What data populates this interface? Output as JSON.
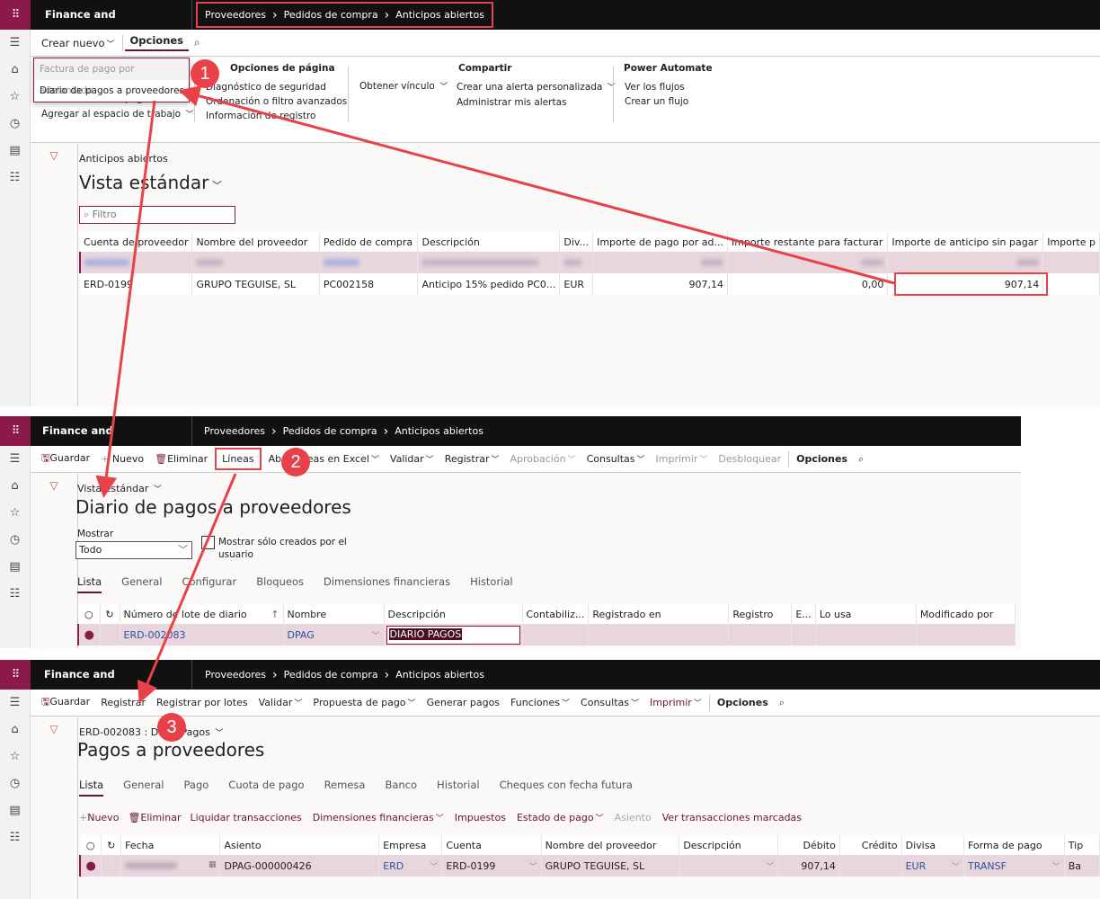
{
  "app_name": "Finance and Operations",
  "breadcrumb": [
    "Proveedores",
    "Pedidos de compra",
    "Anticipos abiertos"
  ],
  "annotations": {
    "badge1": "1",
    "badge2": "2",
    "badge3": "3"
  },
  "panel1": {
    "actions": {
      "create_new": "Crear nuevo",
      "options": "Opciones"
    },
    "dropdown": {
      "item1": "Factura de pago por adelantado",
      "item2": "Diario de pagos a proveedores"
    },
    "ribbon": {
      "behind1": "Personalizar esta página",
      "behind2": "Agregar al espacio de trabajo",
      "page_options_title": "Opciones de página",
      "page_options": [
        "Diagnóstico de seguridad",
        "Ordenación o filtro avanzados",
        "Información de registro"
      ],
      "get_link": "Obtener vínculo",
      "share_title": "Compartir",
      "share": [
        "Crear una alerta personalizada",
        "Administrar mis alertas"
      ],
      "pa_title": "Power Automate",
      "pa": [
        "Ver los flujos",
        "Crear un flujo"
      ]
    },
    "caption": "Anticipos abiertos",
    "view_title": "Vista estándar",
    "filter_placeholder": "Filtro",
    "columns": [
      "Cuenta de proveedor",
      "Nombre del proveedor",
      "Pedido de compra",
      "Descripción",
      "Div...",
      "Importe de pago por ad...",
      "Importe restante para facturar",
      "Importe de anticipo sin pagar",
      "Importe p"
    ],
    "row": {
      "account": "ERD-0199",
      "name": "GRUPO TEGUISE, SL",
      "po": "PC002158",
      "description": "Anticipo 15% pedido PC0...",
      "currency": "EUR",
      "prepayment": "907,14",
      "remaining": "0,00",
      "unpaid": "907,14"
    }
  },
  "panel2": {
    "actions": {
      "save": "Guardar",
      "new": "Nuevo",
      "delete": "Eliminar",
      "lines": "Líneas",
      "open_excel": "Abrir líneas en Excel",
      "validate": "Validar",
      "post": "Registrar",
      "approval": "Aprobación",
      "inquiries": "Consultas",
      "print": "Imprimir",
      "unlock": "Desbloquear",
      "options": "Opciones"
    },
    "view_label": "Vista estándar",
    "title": "Diario de pagos a proveedores",
    "show_label": "Mostrar",
    "show_value": "Todo",
    "checkbox_label": "Mostrar sólo creados por el usuario",
    "tabs": [
      "Lista",
      "General",
      "Configurar",
      "Bloqueos",
      "Dimensiones financieras",
      "Historial"
    ],
    "columns": [
      "Número de lote de diario",
      "Nombre",
      "Descripción",
      "Contabiliz...",
      "Registrado en",
      "Registro",
      "E...",
      "Lo usa",
      "Modificado por"
    ],
    "row": {
      "batch": "ERD-002083",
      "name": "DPAG",
      "description": "DIARIO PAGOS"
    }
  },
  "panel3": {
    "actions": {
      "save": "Guardar",
      "post": "Registrar",
      "post_batch": "Registrar por lotes",
      "validate": "Validar",
      "proposal": "Propuesta de pago",
      "generate": "Generar pagos",
      "functions": "Funciones",
      "inquiries": "Consultas",
      "print": "Imprimir",
      "options": "Opciones"
    },
    "caption": "ERD-002083 : DPAG Pagos",
    "title": "Pagos a proveedores",
    "tabs": [
      "Lista",
      "General",
      "Pago",
      "Cuota de pago",
      "Remesa",
      "Banco",
      "Historial",
      "Cheques con fecha futura"
    ],
    "grid_actions": {
      "new": "Nuevo",
      "delete": "Eliminar",
      "settle": "Liquidar transacciones",
      "dims": "Dimensiones financieras",
      "taxes": "Impuestos",
      "status": "Estado de pago",
      "voucher": "Asiento",
      "marked": "Ver transacciones marcadas"
    },
    "columns": [
      "Fecha",
      "Asiento",
      "Empresa",
      "Cuenta",
      "Nombre del proveedor",
      "Descripción",
      "Débito",
      "Crédito",
      "Divisa",
      "Forma de pago",
      "Tip"
    ],
    "row": {
      "voucher": "DPAG-000000426",
      "company": "ERD",
      "account": "ERD-0199",
      "name": "GRUPO TEGUISE, SL",
      "debit": "907,14",
      "currency": "EUR",
      "method": "TRANSF",
      "type": "Ba"
    }
  }
}
